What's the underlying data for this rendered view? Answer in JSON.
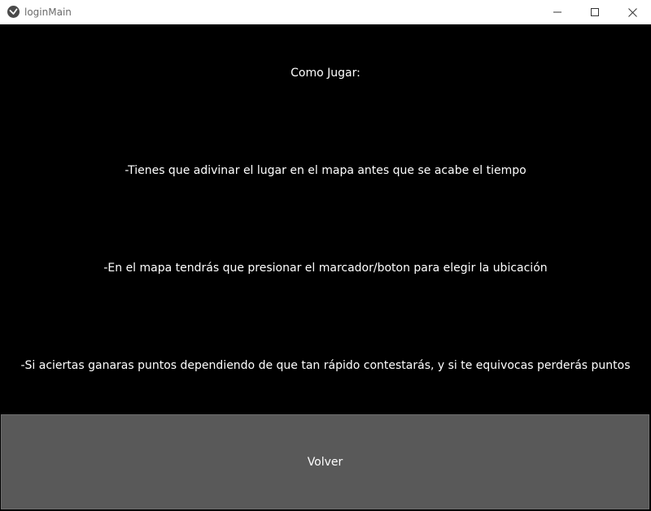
{
  "window": {
    "title": "loginMain",
    "controls": {
      "minimize_icon": "minimize-icon",
      "maximize_icon": "maximize-icon",
      "close_icon": "close-icon"
    }
  },
  "help": {
    "heading": "Como Jugar:",
    "lines": [
      "-Tienes que adivinar el lugar en el mapa antes que se acabe el tiempo",
      "-En el mapa tendrás que presionar el marcador/boton para elegir la ubicación",
      "-Si aciertas ganaras puntos dependiendo de que tan rápido contestarás, y si te equivocas perderás puntos"
    ]
  },
  "actions": {
    "back_label": "Volver"
  },
  "colors": {
    "background": "#000000",
    "button": "#595959",
    "text": "#ffffff",
    "titlebar": "#ffffff"
  }
}
